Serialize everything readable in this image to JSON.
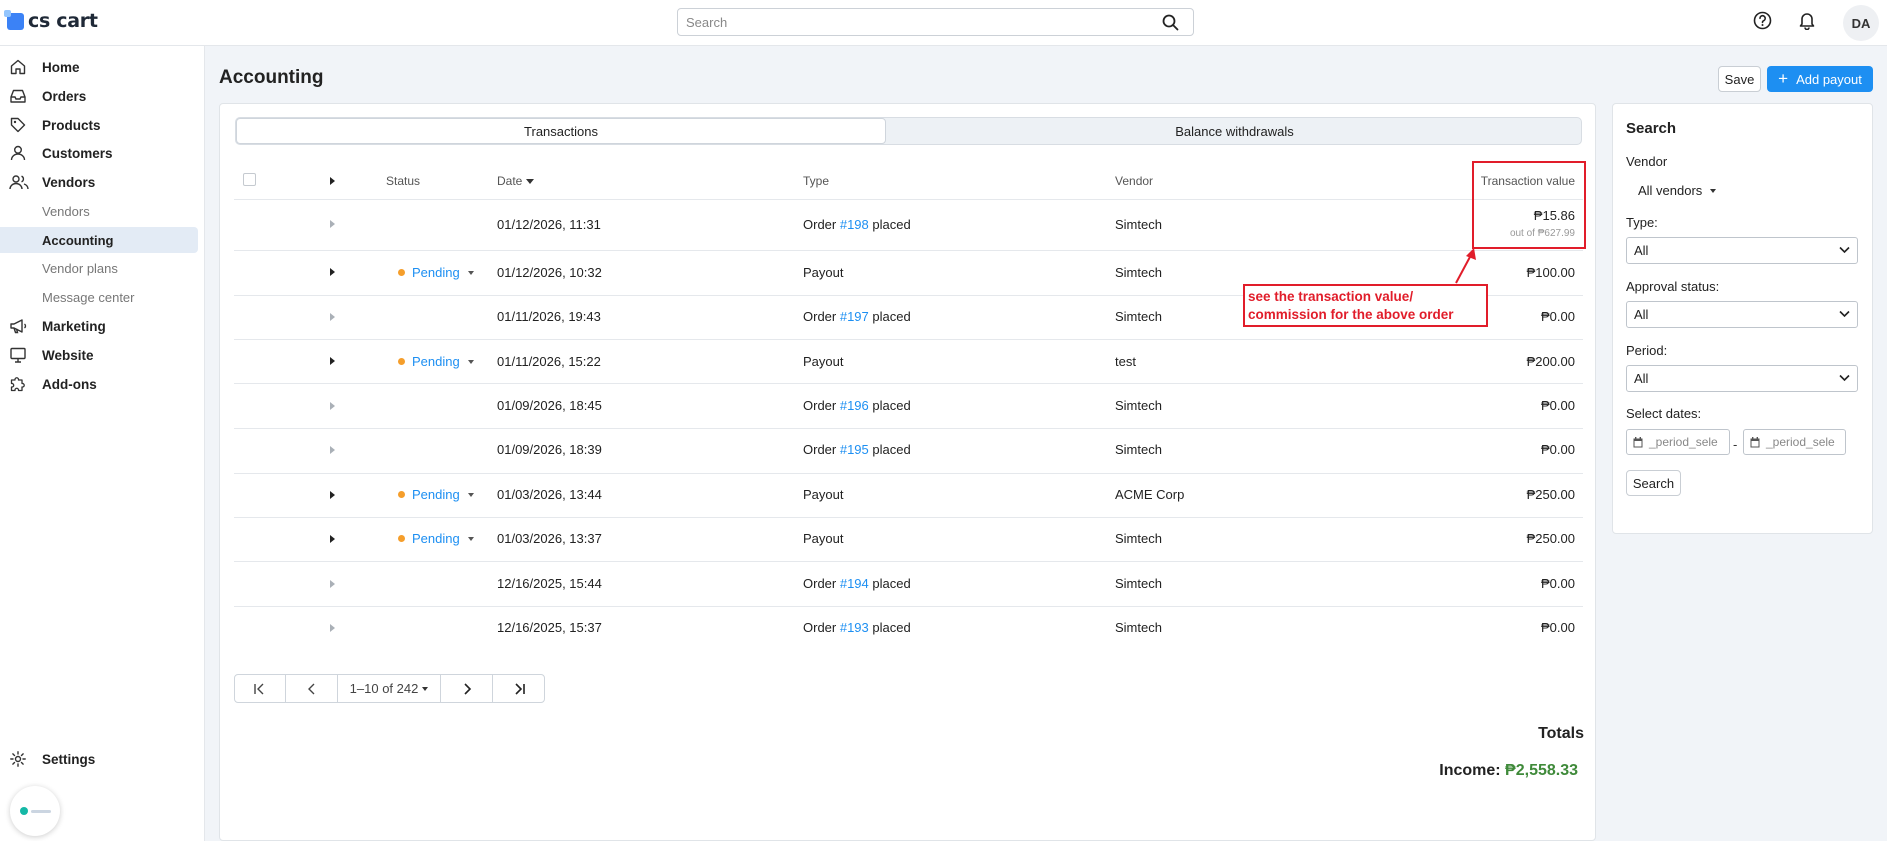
{
  "brand": {
    "logo_text": "cs cart"
  },
  "topbar": {
    "search_placeholder": "Search",
    "avatar_initials": "DA"
  },
  "sidebar": {
    "items": [
      {
        "label": "Home",
        "icon": "home-icon"
      },
      {
        "label": "Orders",
        "icon": "inbox-icon"
      },
      {
        "label": "Products",
        "icon": "tag-icon"
      },
      {
        "label": "Customers",
        "icon": "user-icon"
      },
      {
        "label": "Vendors",
        "icon": "users-icon"
      }
    ],
    "vendor_sub": [
      "Vendors",
      "Accounting",
      "Vendor plans",
      "Message center"
    ],
    "items2": [
      {
        "label": "Marketing",
        "icon": "megaphone-icon"
      },
      {
        "label": "Website",
        "icon": "monitor-icon"
      },
      {
        "label": "Add-ons",
        "icon": "puzzle-icon"
      }
    ],
    "settings": "Settings"
  },
  "page": {
    "title": "Accounting",
    "save_label": "Save",
    "add_payout_label": "Add payout"
  },
  "tabs": [
    "Transactions",
    "Balance withdrawals"
  ],
  "table": {
    "headers": {
      "status": "Status",
      "date": "Date",
      "type": "Type",
      "vendor": "Vendor",
      "value": "Transaction value"
    },
    "rows": [
      {
        "status": "",
        "date": "01/12/2026, 11:31",
        "type_prefix": "Order ",
        "order": "#198",
        "type_suffix": " placed",
        "vendor": "Simtech",
        "value": "₱15.86",
        "subvalue": "out of ₱627.99"
      },
      {
        "status": "Pending",
        "date": "01/12/2026, 10:32",
        "type_prefix": "Payout",
        "order": "",
        "type_suffix": "",
        "vendor": "Simtech",
        "value": "₱100.00",
        "subvalue": ""
      },
      {
        "status": "",
        "date": "01/11/2026, 19:43",
        "type_prefix": "Order ",
        "order": "#197",
        "type_suffix": " placed",
        "vendor": "Simtech",
        "value": "₱0.00",
        "subvalue": ""
      },
      {
        "status": "Pending",
        "date": "01/11/2026, 15:22",
        "type_prefix": "Payout",
        "order": "",
        "type_suffix": "",
        "vendor": "test",
        "value": "₱200.00",
        "subvalue": ""
      },
      {
        "status": "",
        "date": "01/09/2026, 18:45",
        "type_prefix": "Order ",
        "order": "#196",
        "type_suffix": " placed",
        "vendor": "Simtech",
        "value": "₱0.00",
        "subvalue": ""
      },
      {
        "status": "",
        "date": "01/09/2026, 18:39",
        "type_prefix": "Order ",
        "order": "#195",
        "type_suffix": " placed",
        "vendor": "Simtech",
        "value": "₱0.00",
        "subvalue": ""
      },
      {
        "status": "Pending",
        "date": "01/03/2026, 13:44",
        "type_prefix": "Payout",
        "order": "",
        "type_suffix": "",
        "vendor": "ACME Corp",
        "value": "₱250.00",
        "subvalue": ""
      },
      {
        "status": "Pending",
        "date": "01/03/2026, 13:37",
        "type_prefix": "Payout",
        "order": "",
        "type_suffix": "",
        "vendor": "Simtech",
        "value": "₱250.00",
        "subvalue": ""
      },
      {
        "status": "",
        "date": "12/16/2025, 15:44",
        "type_prefix": "Order ",
        "order": "#194",
        "type_suffix": " placed",
        "vendor": "Simtech",
        "value": "₱0.00",
        "subvalue": ""
      },
      {
        "status": "",
        "date": "12/16/2025, 15:37",
        "type_prefix": "Order ",
        "order": "#193",
        "type_suffix": " placed",
        "vendor": "Simtech",
        "value": "₱0.00",
        "subvalue": ""
      }
    ]
  },
  "annotation": {
    "line1": "see the transaction value/",
    "line2": "commission for the above order",
    "color": "#e11d2a"
  },
  "pagination": {
    "range": "1–10 of 242"
  },
  "totals": {
    "title": "Totals",
    "income_label": "Income: ",
    "income_value": "₱2,558.33"
  },
  "search_panel": {
    "title": "Search",
    "vendor_label": "Vendor",
    "vendor_value": "All vendors",
    "type_label": "Type:",
    "type_value": "All",
    "approval_label": "Approval status:",
    "approval_value": "All",
    "period_label": "Period:",
    "period_value": "All",
    "dates_label": "Select dates:",
    "date_from_placeholder": "_period_sele",
    "date_to_placeholder": "_period_sele",
    "date_separator": "-",
    "search_button": "Search"
  },
  "colors": {
    "accent": "#1d8ff2",
    "pending": "#f59e2b",
    "income": "#3f8a3a"
  }
}
